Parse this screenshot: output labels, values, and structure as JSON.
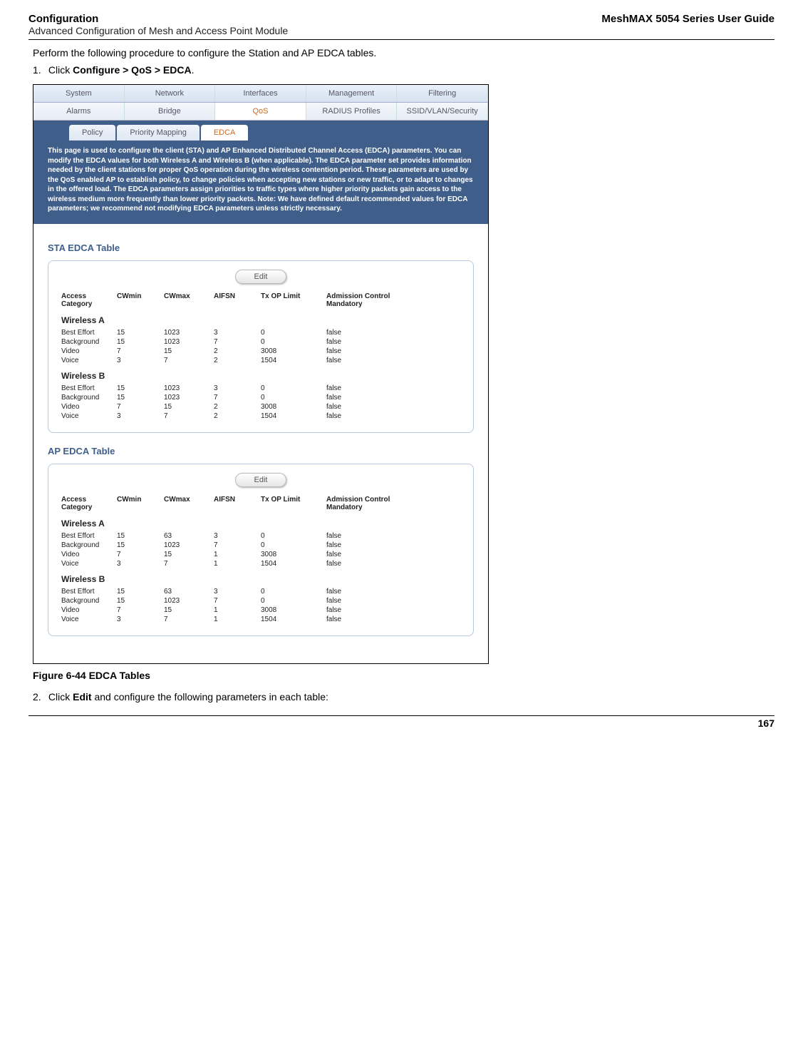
{
  "header": {
    "leftMain": "Configuration",
    "leftSub": "Advanced Configuration of Mesh and Access Point Module",
    "right": "MeshMAX 5054 Series User Guide"
  },
  "intro": "Perform the following procedure to configure the Station and AP EDCA tables.",
  "step1": {
    "num": "1.",
    "pre": "Click ",
    "bold": "Configure > QoS > EDCA",
    "post": "."
  },
  "tabsTop": [
    "System",
    "Network",
    "Interfaces",
    "Management",
    "Filtering"
  ],
  "tabsMid": [
    "Alarms",
    "Bridge",
    "QoS",
    "RADIUS Profiles",
    "SSID/VLAN/Security"
  ],
  "tabsMidActiveIndex": 2,
  "subtabs": [
    "Policy",
    "Priority Mapping",
    "EDCA"
  ],
  "subtabActiveIndex": 2,
  "descText": "This page is used to configure the client (STA) and AP Enhanced Distributed Channel Access (EDCA) parameters. You can modify the EDCA values for both Wireless A and Wireless B (when applicable). The EDCA parameter set provides information needed by the client stations for proper QoS operation during the wireless contention period. These parameters are used by the QoS enabled AP to establish policy, to change policies when accepting new stations or new traffic, or to adapt to changes in the offered load. The EDCA parameters assign priorities to traffic types where higher priority packets gain access to the wireless medium more frequently than lower priority packets. Note: We have defined default recommended values for EDCA parameters; we recommend not modifying EDCA parameters unless strictly necessary.",
  "editLabel": "Edit",
  "colHeaders": {
    "acc": "Access Category",
    "cwmin": "CWmin",
    "cwmax": "CWmax",
    "aifsn": "AIFSN",
    "txop": "Tx OP Limit",
    "adm": "Admission Control Mandatory"
  },
  "staTable": {
    "title": "STA EDCA Table",
    "sections": [
      {
        "name": "Wireless A",
        "rows": [
          {
            "acc": "Best Effort",
            "cwmin": "15",
            "cwmax": "1023",
            "aifsn": "3",
            "txop": "0",
            "adm": "false"
          },
          {
            "acc": "Background",
            "cwmin": "15",
            "cwmax": "1023",
            "aifsn": "7",
            "txop": "0",
            "adm": "false"
          },
          {
            "acc": "Video",
            "cwmin": "7",
            "cwmax": "15",
            "aifsn": "2",
            "txop": "3008",
            "adm": "false"
          },
          {
            "acc": "Voice",
            "cwmin": "3",
            "cwmax": "7",
            "aifsn": "2",
            "txop": "1504",
            "adm": "false"
          }
        ]
      },
      {
        "name": "Wireless B",
        "rows": [
          {
            "acc": "Best Effort",
            "cwmin": "15",
            "cwmax": "1023",
            "aifsn": "3",
            "txop": "0",
            "adm": "false"
          },
          {
            "acc": "Background",
            "cwmin": "15",
            "cwmax": "1023",
            "aifsn": "7",
            "txop": "0",
            "adm": "false"
          },
          {
            "acc": "Video",
            "cwmin": "7",
            "cwmax": "15",
            "aifsn": "2",
            "txop": "3008",
            "adm": "false"
          },
          {
            "acc": "Voice",
            "cwmin": "3",
            "cwmax": "7",
            "aifsn": "2",
            "txop": "1504",
            "adm": "false"
          }
        ]
      }
    ]
  },
  "apTable": {
    "title": "AP EDCA Table",
    "sections": [
      {
        "name": "Wireless A",
        "rows": [
          {
            "acc": "Best Effort",
            "cwmin": "15",
            "cwmax": "63",
            "aifsn": "3",
            "txop": "0",
            "adm": "false"
          },
          {
            "acc": "Background",
            "cwmin": "15",
            "cwmax": "1023",
            "aifsn": "7",
            "txop": "0",
            "adm": "false"
          },
          {
            "acc": "Video",
            "cwmin": "7",
            "cwmax": "15",
            "aifsn": "1",
            "txop": "3008",
            "adm": "false"
          },
          {
            "acc": "Voice",
            "cwmin": "3",
            "cwmax": "7",
            "aifsn": "1",
            "txop": "1504",
            "adm": "false"
          }
        ]
      },
      {
        "name": "Wireless B",
        "rows": [
          {
            "acc": "Best Effort",
            "cwmin": "15",
            "cwmax": "63",
            "aifsn": "3",
            "txop": "0",
            "adm": "false"
          },
          {
            "acc": "Background",
            "cwmin": "15",
            "cwmax": "1023",
            "aifsn": "7",
            "txop": "0",
            "adm": "false"
          },
          {
            "acc": "Video",
            "cwmin": "7",
            "cwmax": "15",
            "aifsn": "1",
            "txop": "3008",
            "adm": "false"
          },
          {
            "acc": "Voice",
            "cwmin": "3",
            "cwmax": "7",
            "aifsn": "1",
            "txop": "1504",
            "adm": "false"
          }
        ]
      }
    ]
  },
  "figureCaption": "Figure 6-44 EDCA Tables",
  "step2": {
    "num": "2.",
    "pre": "Click ",
    "bold": "Edit",
    "post": " and configure the following parameters in each table:"
  },
  "pageNum": "167"
}
